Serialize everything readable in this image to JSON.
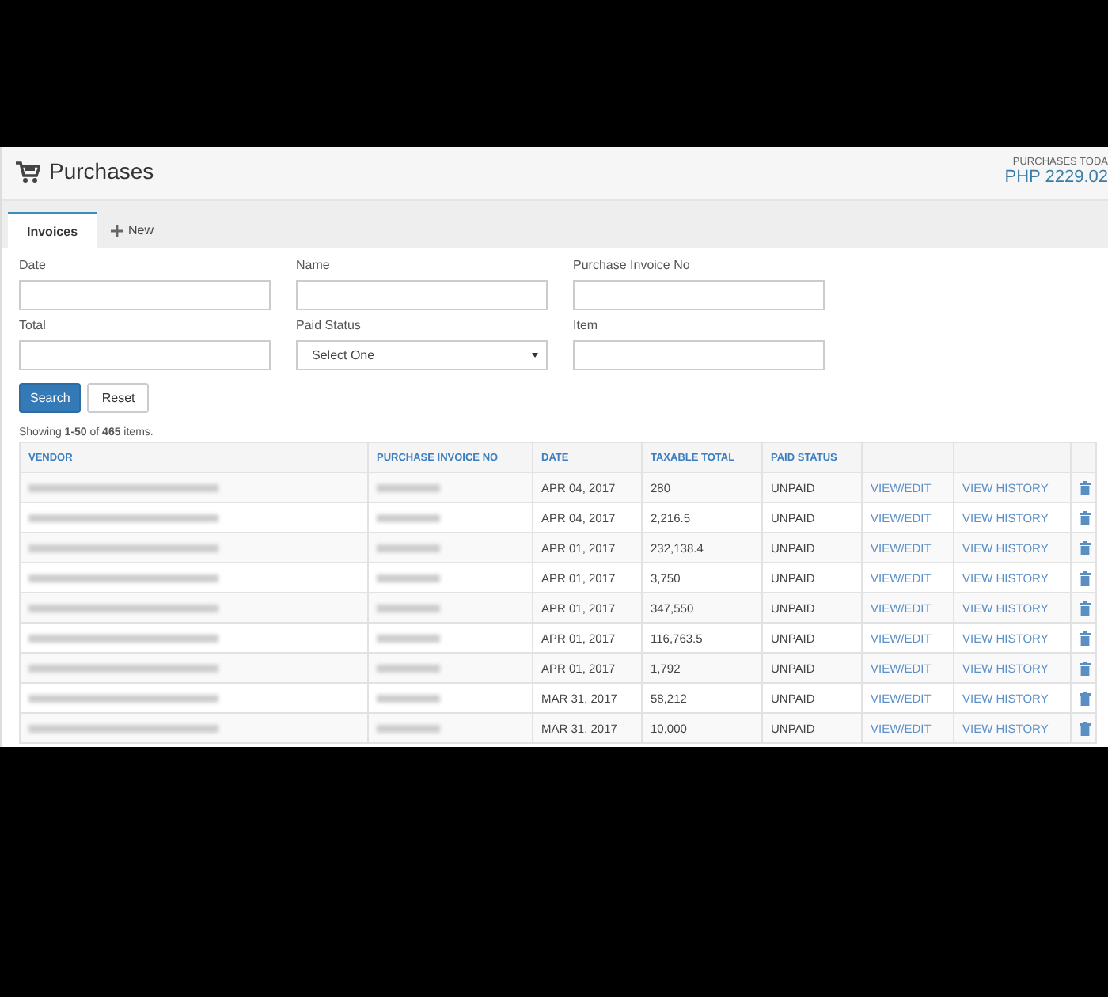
{
  "header": {
    "title": "Purchases",
    "summary_label": "PURCHASES TODA",
    "summary_value": "PHP 2229.02"
  },
  "tabs": [
    {
      "label": "Invoices",
      "kind": "list",
      "selected": true
    },
    {
      "label": "New",
      "kind": "add",
      "selected": false
    }
  ],
  "filters": [
    {
      "label": "Date",
      "kind": "text"
    },
    {
      "label": "Name",
      "kind": "text"
    },
    {
      "label": "Purchase Invoice No",
      "kind": "text"
    },
    {
      "label": "Total",
      "kind": "text"
    },
    {
      "label": "Paid Status",
      "kind": "select",
      "value": "Select One"
    },
    {
      "label": "Item",
      "kind": "text"
    }
  ],
  "buttons": [
    {
      "label": "Search",
      "primary": true
    },
    {
      "label": "Reset",
      "primary": false
    }
  ],
  "summary": "Showing **1-50** of **465** items.",
  "table": {
    "columns": [
      "VENDOR",
      "PURCHASE INVOICE NO",
      "DATE",
      "TAXABLE TOTAL",
      "PAID STATUS"
    ],
    "rows": [
      {
        "vendor_blurred": true,
        "invoice_blurred": true,
        "date": "APR 04, 2017",
        "total": "280",
        "status": "UNPAID",
        "view": "VIEW/EDIT",
        "history": "VIEW HISTORY"
      },
      {
        "vendor_blurred": true,
        "invoice_blurred": true,
        "date": "APR 04, 2017",
        "total": "2,216.5",
        "status": "UNPAID",
        "view": "VIEW/EDIT",
        "history": "VIEW HISTORY"
      },
      {
        "vendor_blurred": true,
        "invoice_blurred": true,
        "date": "APR 01, 2017",
        "total": "232,138.4",
        "status": "UNPAID",
        "view": "VIEW/EDIT",
        "history": "VIEW HISTORY"
      },
      {
        "vendor_blurred": true,
        "invoice_blurred": true,
        "date": "APR 01, 2017",
        "total": "3,750",
        "status": "UNPAID",
        "view": "VIEW/EDIT",
        "history": "VIEW HISTORY"
      },
      {
        "vendor_blurred": true,
        "invoice_blurred": true,
        "date": "APR 01, 2017",
        "total": "347,550",
        "status": "UNPAID",
        "view": "VIEW/EDIT",
        "history": "VIEW HISTORY"
      },
      {
        "vendor_blurred": true,
        "invoice_blurred": true,
        "date": "APR 01, 2017",
        "total": "116,763.5",
        "status": "UNPAID",
        "view": "VIEW/EDIT",
        "history": "VIEW HISTORY"
      },
      {
        "vendor_blurred": true,
        "invoice_blurred": true,
        "date": "APR 01, 2017",
        "total": "1,792",
        "status": "UNPAID",
        "view": "VIEW/EDIT",
        "history": "VIEW HISTORY"
      },
      {
        "vendor_blurred": true,
        "invoice_blurred": true,
        "date": "MAR 31, 2017",
        "total": "58,212",
        "status": "UNPAID",
        "view": "VIEW/EDIT",
        "history": "VIEW HISTORY"
      },
      {
        "vendor_blurred": true,
        "invoice_blurred": true,
        "date": "MAR 31, 2017",
        "total": "10,000",
        "status": "UNPAID",
        "view": "VIEW/EDIT",
        "history": "VIEW HISTORY"
      }
    ]
  }
}
